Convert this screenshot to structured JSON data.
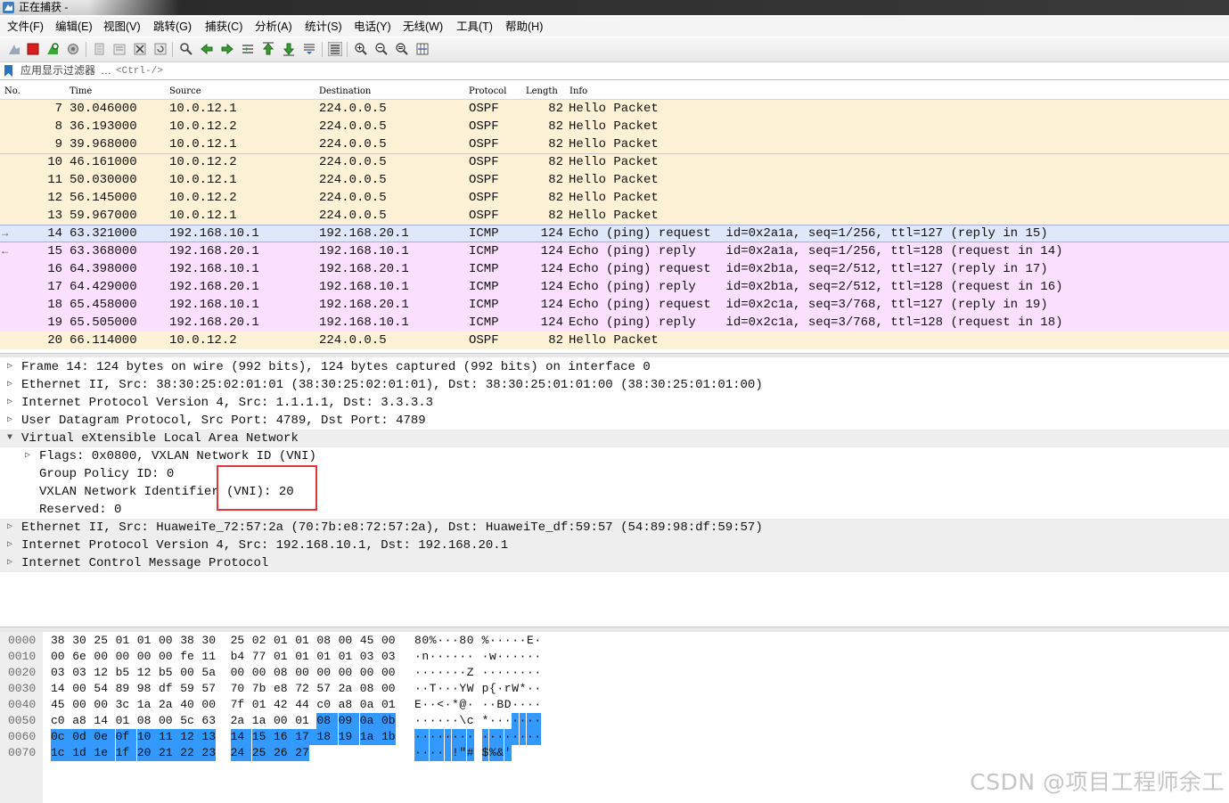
{
  "window": {
    "title": "正在捕获 -"
  },
  "menu": [
    "文件(F)",
    "编辑(E)",
    "视图(V)",
    "跳转(G)",
    "捕获(C)",
    "分析(A)",
    "统计(S)",
    "电话(Y)",
    "无线(W)",
    "工具(T)",
    "帮助(H)"
  ],
  "toolbar": {
    "icons": [
      "shark-fin-start-icon",
      "stop-capture-icon",
      "restart-capture-icon",
      "capture-options-icon",
      "open-file-icon",
      "save-file-icon",
      "close-file-icon",
      "reload-file-icon",
      "find-packet-icon",
      "go-back-icon",
      "go-forward-icon",
      "go-to-packet-icon",
      "go-first-icon",
      "go-last-icon",
      "autoscroll-icon",
      "colorize-icon",
      "zoom-in-icon",
      "zoom-out-icon",
      "zoom-normal-icon",
      "resize-columns-icon"
    ]
  },
  "filter": {
    "label": "应用显示过滤器",
    "dots": "…",
    "placeholder": "<Ctrl-/>"
  },
  "columns": {
    "no": "No.",
    "time": "Time",
    "source": "Source",
    "destination": "Destination",
    "protocol": "Protocol",
    "length": "Length",
    "info": "Info"
  },
  "colors": {
    "ospf_bg": "#fdf1d6",
    "icmp_bg": "#fce0ff",
    "selected_bg": "#dfe7fb",
    "highlight": "#3399ff",
    "annotation": "#e0353b"
  },
  "packets": [
    {
      "no": "7",
      "time": "30.046000",
      "src": "10.0.12.1",
      "dst": "224.0.0.5",
      "proto": "OSPF",
      "len": "82",
      "info": "Hello Packet",
      "kind": "ospf",
      "arrow": ""
    },
    {
      "no": "8",
      "time": "36.193000",
      "src": "10.0.12.2",
      "dst": "224.0.0.5",
      "proto": "OSPF",
      "len": "82",
      "info": "Hello Packet",
      "kind": "ospf",
      "arrow": ""
    },
    {
      "no": "9",
      "time": "39.968000",
      "src": "10.0.12.1",
      "dst": "224.0.0.5",
      "proto": "OSPF",
      "len": "82",
      "info": "Hello Packet",
      "kind": "ospf",
      "arrow": ""
    },
    {
      "no": "10",
      "time": "46.161000",
      "src": "10.0.12.2",
      "dst": "224.0.0.5",
      "proto": "OSPF",
      "len": "82",
      "info": "Hello Packet",
      "kind": "ospf",
      "arrow": ""
    },
    {
      "no": "11",
      "time": "50.030000",
      "src": "10.0.12.1",
      "dst": "224.0.0.5",
      "proto": "OSPF",
      "len": "82",
      "info": "Hello Packet",
      "kind": "ospf",
      "arrow": ""
    },
    {
      "no": "12",
      "time": "56.145000",
      "src": "10.0.12.2",
      "dst": "224.0.0.5",
      "proto": "OSPF",
      "len": "82",
      "info": "Hello Packet",
      "kind": "ospf",
      "arrow": ""
    },
    {
      "no": "13",
      "time": "59.967000",
      "src": "10.0.12.1",
      "dst": "224.0.0.5",
      "proto": "OSPF",
      "len": "82",
      "info": "Hello Packet",
      "kind": "ospf",
      "arrow": ""
    },
    {
      "no": "14",
      "time": "63.321000",
      "src": "192.168.10.1",
      "dst": "192.168.20.1",
      "proto": "ICMP",
      "len": "124",
      "info": "Echo (ping) request  id=0x2a1a, seq=1/256, ttl=127 (reply in 15)",
      "kind": "selected",
      "arrow": "→"
    },
    {
      "no": "15",
      "time": "63.368000",
      "src": "192.168.20.1",
      "dst": "192.168.10.1",
      "proto": "ICMP",
      "len": "124",
      "info": "Echo (ping) reply    id=0x2a1a, seq=1/256, ttl=128 (request in 14)",
      "kind": "icmp",
      "arrow": "←"
    },
    {
      "no": "16",
      "time": "64.398000",
      "src": "192.168.10.1",
      "dst": "192.168.20.1",
      "proto": "ICMP",
      "len": "124",
      "info": "Echo (ping) request  id=0x2b1a, seq=2/512, ttl=127 (reply in 17)",
      "kind": "icmp",
      "arrow": ""
    },
    {
      "no": "17",
      "time": "64.429000",
      "src": "192.168.20.1",
      "dst": "192.168.10.1",
      "proto": "ICMP",
      "len": "124",
      "info": "Echo (ping) reply    id=0x2b1a, seq=2/512, ttl=128 (request in 16)",
      "kind": "icmp",
      "arrow": ""
    },
    {
      "no": "18",
      "time": "65.458000",
      "src": "192.168.10.1",
      "dst": "192.168.20.1",
      "proto": "ICMP",
      "len": "124",
      "info": "Echo (ping) request  id=0x2c1a, seq=3/768, ttl=127 (reply in 19)",
      "kind": "icmp",
      "arrow": ""
    },
    {
      "no": "19",
      "time": "65.505000",
      "src": "192.168.20.1",
      "dst": "192.168.10.1",
      "proto": "ICMP",
      "len": "124",
      "info": "Echo (ping) reply    id=0x2c1a, seq=3/768, ttl=128 (request in 18)",
      "kind": "icmp",
      "arrow": ""
    },
    {
      "no": "20",
      "time": "66.114000",
      "src": "10.0.12.2",
      "dst": "224.0.0.5",
      "proto": "OSPF",
      "len": "82",
      "info": "Hello Packet",
      "kind": "ospf",
      "arrow": ""
    }
  ],
  "details": [
    {
      "text": "Frame 14: 124 bytes on wire (992 bits), 124 bytes captured (992 bits) on interface 0",
      "level": 0,
      "twisty": "closed",
      "shade": false
    },
    {
      "text": "Ethernet II, Src: 38:30:25:02:01:01 (38:30:25:02:01:01), Dst: 38:30:25:01:01:00 (38:30:25:01:01:00)",
      "level": 0,
      "twisty": "closed",
      "shade": false
    },
    {
      "text": "Internet Protocol Version 4, Src: 1.1.1.1, Dst: 3.3.3.3",
      "level": 0,
      "twisty": "closed",
      "shade": false
    },
    {
      "text": "User Datagram Protocol, Src Port: 4789, Dst Port: 4789",
      "level": 0,
      "twisty": "closed",
      "shade": false
    },
    {
      "text": "Virtual eXtensible Local Area Network",
      "level": 0,
      "twisty": "open",
      "shade": true
    },
    {
      "text": "Flags: 0x0800, VXLAN Network ID (VNI)",
      "level": 1,
      "twisty": "closed",
      "shade": false
    },
    {
      "text": "Group Policy ID: 0",
      "level": 1,
      "twisty": "",
      "shade": false
    },
    {
      "text": "VXLAN Network Identifier (VNI): 20",
      "level": 1,
      "twisty": "",
      "shade": false
    },
    {
      "text": "Reserved: 0",
      "level": 1,
      "twisty": "",
      "shade": false
    },
    {
      "text": "Ethernet II, Src: HuaweiTe_72:57:2a (70:7b:e8:72:57:2a), Dst: HuaweiTe_df:59:57 (54:89:98:df:59:57)",
      "level": 0,
      "twisty": "closed",
      "shade": true
    },
    {
      "text": "Internet Protocol Version 4, Src: 192.168.10.1, Dst: 192.168.20.1",
      "level": 0,
      "twisty": "closed",
      "shade": true
    },
    {
      "text": "Internet Control Message Protocol",
      "level": 0,
      "twisty": "closed",
      "shade": true
    }
  ],
  "bytes": [
    {
      "offset": "0000",
      "hex": [
        "38",
        "30",
        "25",
        "01",
        "01",
        "00",
        "38",
        "30",
        "25",
        "02",
        "01",
        "01",
        "08",
        "00",
        "45",
        "00"
      ],
      "ascii": [
        "8",
        "0",
        "%",
        "·",
        "·",
        "·",
        "8",
        "0",
        "%",
        "·",
        "·",
        "·",
        "·",
        "·",
        "E",
        "·"
      ],
      "hl_from": 16
    },
    {
      "offset": "0010",
      "hex": [
        "00",
        "6e",
        "00",
        "00",
        "00",
        "00",
        "fe",
        "11",
        "b4",
        "77",
        "01",
        "01",
        "01",
        "01",
        "03",
        "03"
      ],
      "ascii": [
        "·",
        "n",
        "·",
        "·",
        "·",
        "·",
        "·",
        "·",
        "·",
        "w",
        "·",
        "·",
        "·",
        "·",
        "·",
        "·"
      ],
      "hl_from": 16
    },
    {
      "offset": "0020",
      "hex": [
        "03",
        "03",
        "12",
        "b5",
        "12",
        "b5",
        "00",
        "5a",
        "00",
        "00",
        "08",
        "00",
        "00",
        "00",
        "00",
        "00"
      ],
      "ascii": [
        "·",
        "·",
        "·",
        "·",
        "·",
        "·",
        "·",
        "Z",
        "·",
        "·",
        "·",
        "·",
        "·",
        "·",
        "·",
        "·"
      ],
      "hl_from": 16
    },
    {
      "offset": "0030",
      "hex": [
        "14",
        "00",
        "54",
        "89",
        "98",
        "df",
        "59",
        "57",
        "70",
        "7b",
        "e8",
        "72",
        "57",
        "2a",
        "08",
        "00"
      ],
      "ascii": [
        "·",
        "·",
        "T",
        "·",
        "·",
        "·",
        "Y",
        "W",
        "p",
        "{",
        "·",
        "r",
        "W",
        "*",
        "·",
        "·"
      ],
      "hl_from": 16
    },
    {
      "offset": "0040",
      "hex": [
        "45",
        "00",
        "00",
        "3c",
        "1a",
        "2a",
        "40",
        "00",
        "7f",
        "01",
        "42",
        "44",
        "c0",
        "a8",
        "0a",
        "01"
      ],
      "ascii": [
        "E",
        "·",
        "·",
        "<",
        "·",
        "*",
        "@",
        "·",
        "·",
        "·",
        "B",
        "D",
        "·",
        "·",
        "·",
        "·"
      ],
      "hl_from": 16
    },
    {
      "offset": "0050",
      "hex": [
        "c0",
        "a8",
        "14",
        "01",
        "08",
        "00",
        "5c",
        "63",
        "2a",
        "1a",
        "00",
        "01",
        "08",
        "09",
        "0a",
        "0b"
      ],
      "ascii": [
        "·",
        "·",
        "·",
        "·",
        "·",
        "·",
        "\\",
        "c",
        "*",
        "·",
        "·",
        "·",
        "·",
        "·",
        "·",
        "·"
      ],
      "hl_from": 12
    },
    {
      "offset": "0060",
      "hex": [
        "0c",
        "0d",
        "0e",
        "0f",
        "10",
        "11",
        "12",
        "13",
        "14",
        "15",
        "16",
        "17",
        "18",
        "19",
        "1a",
        "1b"
      ],
      "ascii": [
        "·",
        "·",
        "·",
        "·",
        "·",
        "·",
        "·",
        "·",
        "·",
        "·",
        "·",
        "·",
        "·",
        "·",
        "·",
        "·"
      ],
      "hl_from": 0
    },
    {
      "offset": "0070",
      "hex": [
        "1c",
        "1d",
        "1e",
        "1f",
        "20",
        "21",
        "22",
        "23",
        "24",
        "25",
        "26",
        "27"
      ],
      "ascii": [
        "·",
        "·",
        "·",
        "·",
        " ",
        "!",
        "\"",
        "#",
        "$",
        "%",
        "&",
        "'"
      ],
      "hl_from": 0
    }
  ],
  "watermark": "CSDN @项目工程师余工"
}
